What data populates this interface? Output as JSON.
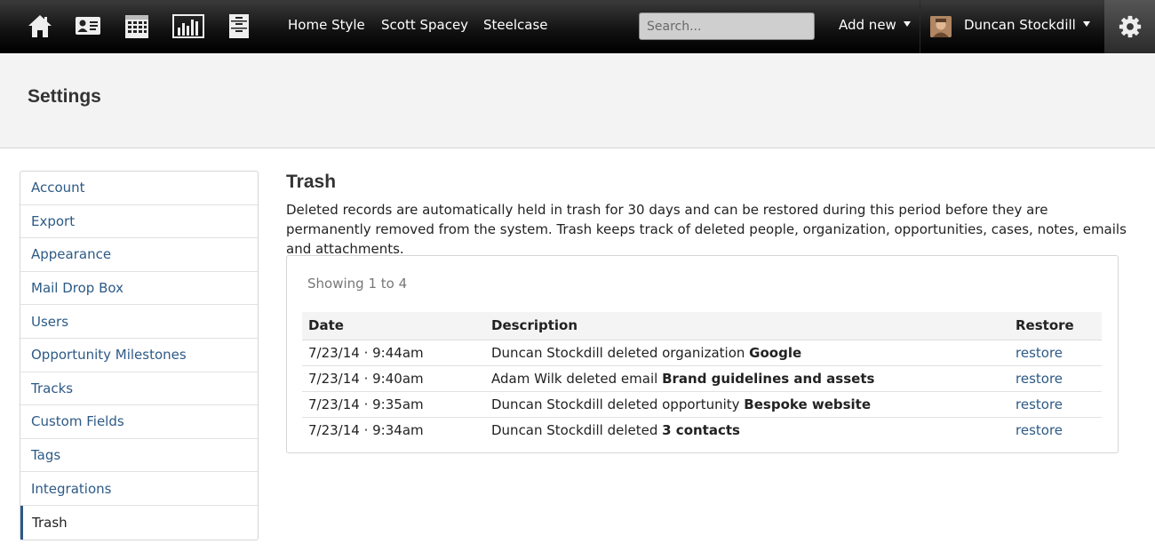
{
  "topnav": {
    "icons": [
      "home-icon",
      "contacts-card-icon",
      "calendar-icon",
      "bar-chart-icon",
      "cabinet-icon"
    ],
    "links": [
      "Home Style",
      "Scott Spacey",
      "Steelcase"
    ],
    "search_placeholder": "Search...",
    "add_new_label": "Add new",
    "user_name": "Duncan Stockdill"
  },
  "page": {
    "title": "Settings"
  },
  "sidebar": {
    "items": [
      {
        "label": "Account"
      },
      {
        "label": "Export"
      },
      {
        "label": "Appearance"
      },
      {
        "label": "Mail Drop Box"
      },
      {
        "label": "Users"
      },
      {
        "label": "Opportunity Milestones"
      },
      {
        "label": "Tracks"
      },
      {
        "label": "Custom Fields"
      },
      {
        "label": "Tags"
      },
      {
        "label": "Integrations"
      },
      {
        "label": "Trash"
      }
    ],
    "active": "Trash"
  },
  "main": {
    "title": "Trash",
    "description": "Deleted records are automatically held in trash for 30 days and can be restored during this period before they are permanently removed from the system. Trash keeps track of deleted people, organization, opportunities, cases, notes, emails and attachments.",
    "showing": "Showing 1 to 4",
    "columns": {
      "date": "Date",
      "description": "Description",
      "restore": "Restore"
    },
    "rows": [
      {
        "date": "7/23/14 · 9:44am",
        "desc_prefix": "Duncan Stockdill deleted organization ",
        "desc_object": "Google",
        "restore": "restore"
      },
      {
        "date": "7/23/14 · 9:40am",
        "desc_prefix": "Adam Wilk deleted email ",
        "desc_object": "Brand guidelines and assets",
        "restore": "restore"
      },
      {
        "date": "7/23/14 · 9:35am",
        "desc_prefix": "Duncan Stockdill deleted opportunity ",
        "desc_object": "Bespoke website",
        "restore": "restore"
      },
      {
        "date": "7/23/14 · 9:34am",
        "desc_prefix": "Duncan Stockdill deleted ",
        "desc_object": "3 contacts",
        "restore": "restore"
      }
    ]
  },
  "colors": {
    "link": "#2d5a86",
    "topbar": "#111111",
    "header_bg": "#f3f3f3"
  }
}
